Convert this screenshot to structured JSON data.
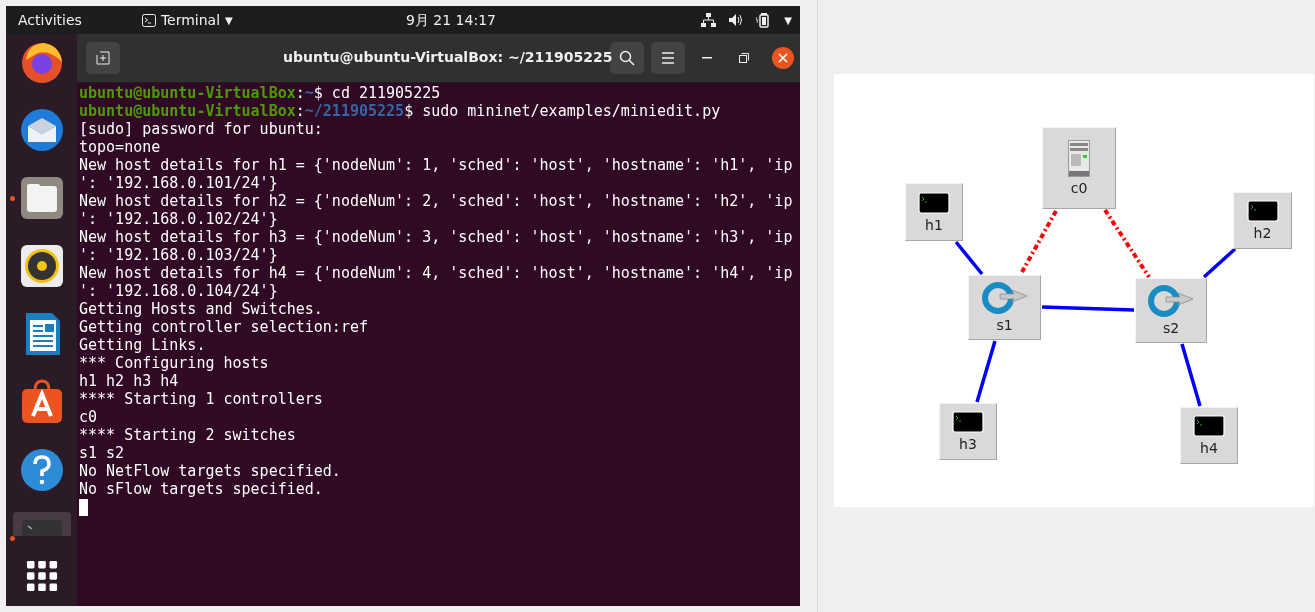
{
  "top_bar": {
    "activities": "Activities",
    "app_menu": "Terminal",
    "app_menu_caret": "▼",
    "clock": "9月 21  14:17",
    "system_caret": "▼"
  },
  "dock": {
    "items": [
      {
        "kind": "firefox"
      },
      {
        "kind": "mail"
      },
      {
        "kind": "files",
        "running": true
      },
      {
        "kind": "audio"
      },
      {
        "kind": "writer"
      },
      {
        "kind": "store"
      },
      {
        "kind": "help"
      },
      {
        "kind": "terminal",
        "running": true
      },
      {
        "kind": "grid"
      }
    ]
  },
  "terminal": {
    "title": "ubuntu@ubuntu-VirtualBox: ~/211905225",
    "lines": [
      [
        {
          "kind": "user",
          "text": "ubuntu@ubuntu-VirtualBox"
        },
        {
          "kind": "text",
          "text": ":"
        },
        {
          "kind": "path",
          "text": "~"
        },
        {
          "kind": "text",
          "text": "$ cd 211905225"
        }
      ],
      [
        {
          "kind": "user",
          "text": "ubuntu@ubuntu-VirtualBox"
        },
        {
          "kind": "text",
          "text": ":"
        },
        {
          "kind": "path",
          "text": "~/211905225"
        },
        {
          "kind": "text",
          "text": "$ sudo mininet/examples/miniedit.py"
        }
      ],
      [
        {
          "kind": "text",
          "text": "[sudo] password for ubuntu:"
        }
      ],
      [
        {
          "kind": "text",
          "text": "topo=none"
        }
      ],
      [
        {
          "kind": "text",
          "text": "New host details for h1 = {'nodeNum': 1, 'sched': 'host', 'hostname': 'h1', 'ip"
        }
      ],
      [
        {
          "kind": "text",
          "text": "': '192.168.0.101/24'}"
        }
      ],
      [
        {
          "kind": "text",
          "text": "New host details for h2 = {'nodeNum': 2, 'sched': 'host', 'hostname': 'h2', 'ip"
        }
      ],
      [
        {
          "kind": "text",
          "text": "': '192.168.0.102/24'}"
        }
      ],
      [
        {
          "kind": "text",
          "text": "New host details for h3 = {'nodeNum': 3, 'sched': 'host', 'hostname': 'h3', 'ip"
        }
      ],
      [
        {
          "kind": "text",
          "text": "': '192.168.0.103/24'}"
        }
      ],
      [
        {
          "kind": "text",
          "text": "New host details for h4 = {'nodeNum': 4, 'sched': 'host', 'hostname': 'h4', 'ip"
        }
      ],
      [
        {
          "kind": "text",
          "text": "': '192.168.0.104/24'}"
        }
      ],
      [
        {
          "kind": "text",
          "text": "Getting Hosts and Switches."
        }
      ],
      [
        {
          "kind": "text",
          "text": "Getting controller selection:ref"
        }
      ],
      [
        {
          "kind": "text",
          "text": "Getting Links."
        }
      ],
      [
        {
          "kind": "text",
          "text": "*** Configuring hosts"
        }
      ],
      [
        {
          "kind": "text",
          "text": "h1 h2 h3 h4"
        }
      ],
      [
        {
          "kind": "text",
          "text": "**** Starting 1 controllers"
        }
      ],
      [
        {
          "kind": "text",
          "text": "c0"
        }
      ],
      [
        {
          "kind": "text",
          "text": "**** Starting 2 switches"
        }
      ],
      [
        {
          "kind": "text",
          "text": "s1 s2"
        }
      ],
      [
        {
          "kind": "text",
          "text": "No NetFlow targets specified."
        }
      ],
      [
        {
          "kind": "text",
          "text": "No sFlow targets specified."
        }
      ]
    ]
  },
  "topology": {
    "nodes": [
      {
        "kind": "controller",
        "label": "c0"
      },
      {
        "kind": "host",
        "label": "h1"
      },
      {
        "kind": "host",
        "label": "h2"
      },
      {
        "kind": "switch",
        "label": "s1"
      },
      {
        "kind": "switch",
        "label": "s2"
      },
      {
        "kind": "host",
        "label": "h3"
      },
      {
        "kind": "host",
        "label": "h4"
      }
    ],
    "links": [
      {
        "kind": "control"
      },
      {
        "kind": "control"
      },
      {
        "kind": "data"
      },
      {
        "kind": "data"
      },
      {
        "kind": "data"
      },
      {
        "kind": "data"
      },
      {
        "kind": "data"
      }
    ]
  }
}
